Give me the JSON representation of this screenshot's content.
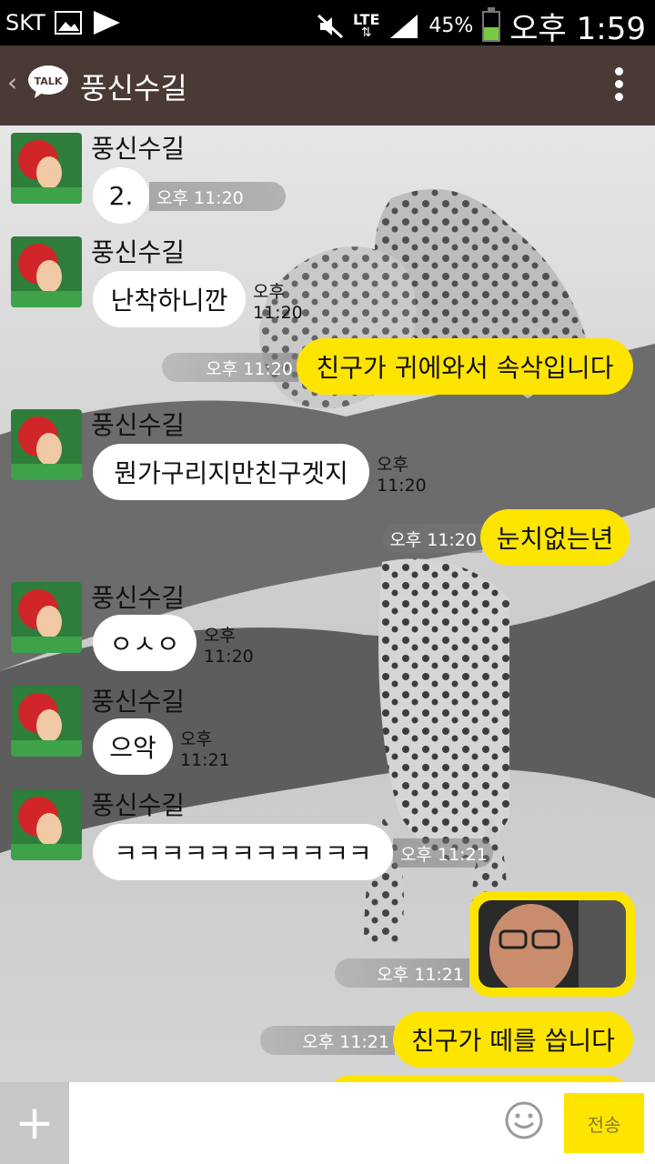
{
  "status": {
    "carrier": "SKT",
    "network": "LTE",
    "battery": "45%",
    "battery_level": 0.45,
    "time": "오후 1:59"
  },
  "header": {
    "title": "풍신수길",
    "talk_label": "TALK"
  },
  "messages": [
    {
      "side": "in",
      "sender": "풍신수길",
      "text": "2.",
      "time": "오후 11:20"
    },
    {
      "side": "in",
      "sender": "풍신수길",
      "text": "난착하니깐",
      "time": "오후 11:20"
    },
    {
      "side": "out",
      "text": "친구가 귀에와서 속삭입니다",
      "time": "오후 11:20"
    },
    {
      "side": "in",
      "sender": "풍신수길",
      "text": "뭔가구리지만친구겟지",
      "time": "오후 11:20"
    },
    {
      "side": "out",
      "text": "눈치없는년",
      "time": "오후 11:20"
    },
    {
      "side": "in",
      "sender": "풍신수길",
      "text": "ㅇㅅㅇ",
      "time": "오후 11:20"
    },
    {
      "side": "in",
      "sender": "풍신수길",
      "text": "으악",
      "time": "오후 11:21"
    },
    {
      "side": "in",
      "sender": "풍신수길",
      "text": "ㅋㅋㅋㅋㅋㅋㅋㅋㅋㅋㅋ",
      "time": "오후 11:21"
    },
    {
      "side": "out",
      "type": "image",
      "time": "오후 11:21"
    },
    {
      "side": "out",
      "text": "친구가 떼를 씁니다",
      "time": "오후 11:21"
    }
  ],
  "input": {
    "placeholder": "",
    "send_label": "전송"
  },
  "colors": {
    "header_bg": "#4a3a35",
    "bubble_out": "#fee500",
    "bubble_in": "#ffffff"
  }
}
